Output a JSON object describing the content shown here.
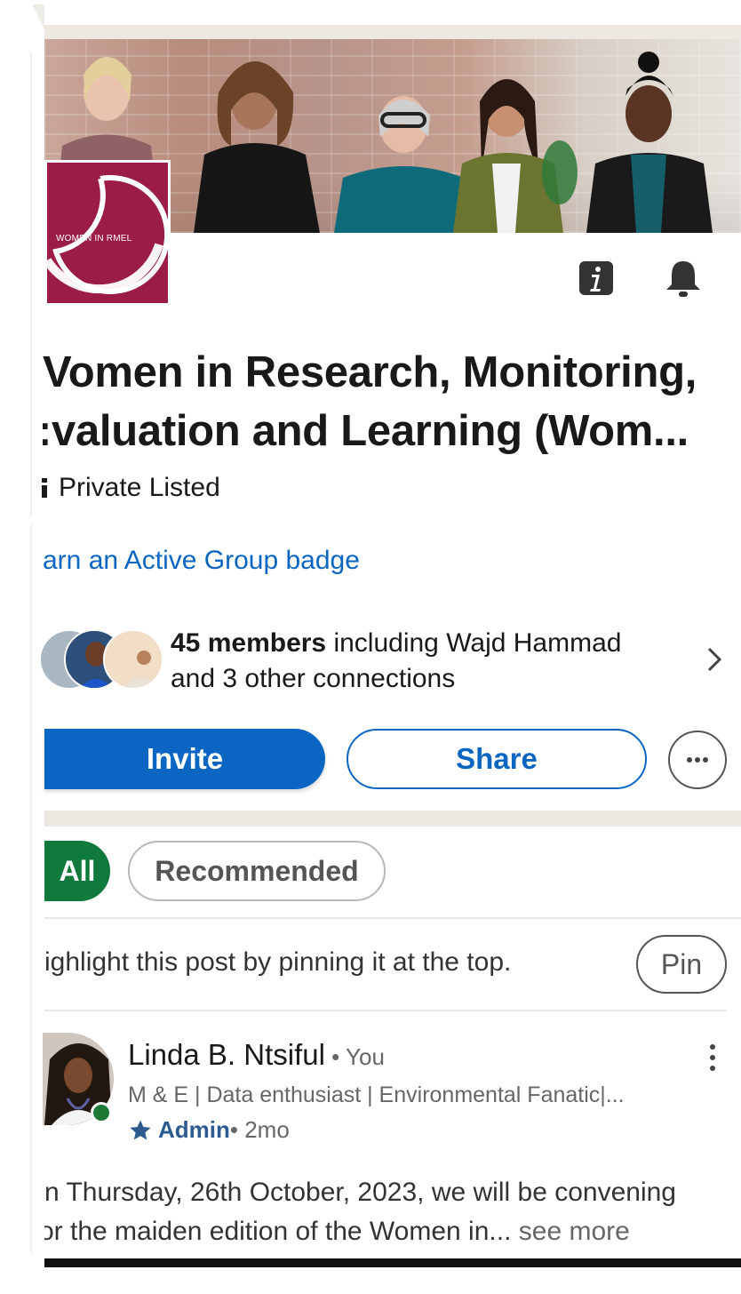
{
  "group": {
    "logo_text": "WOMEN IN RMEL",
    "title_line1": "Vomen in Research, Monitoring,",
    "title_line2": ":valuation and Learning (Wom...",
    "privacy_label": "Private Listed",
    "badge_link": "arn an Active Group badge"
  },
  "members": {
    "count_label": "45 members",
    "rest_line1": " including Wajd Hammad",
    "line2": "and 3 other connections"
  },
  "actions": {
    "invite_label": "Invite",
    "share_label": "Share"
  },
  "filters": {
    "all_label": "All",
    "recommended_label": "Recommended"
  },
  "pin_prompt": {
    "text": "ighlight this post by pinning it at the top.",
    "button_label": "Pin"
  },
  "post": {
    "author": "Linda B. Ntsiful",
    "relation": " • You",
    "headline": "M & E | Data enthusiast | Environmental Fanatic|...",
    "role": "Admin",
    "time": " • 2mo",
    "text_line1": "n Thursday, 26th October, 2023, we will be convening",
    "text_line2": "or the maiden edition of the Women in...",
    "see_more": " see more"
  },
  "colors": {
    "brand_blue": "#0a66c2",
    "chip_green": "#0f7a3b",
    "logo_maroon": "#9b1d46",
    "presence_green": "#1c7a35"
  }
}
